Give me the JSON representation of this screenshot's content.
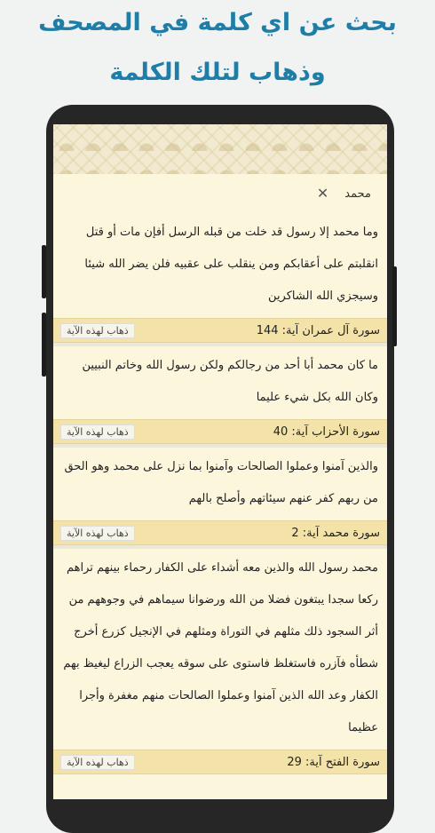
{
  "headline": {
    "line1": "بحث عن اي كلمة في المصحف",
    "line2": "وذهاب لتلك الكلمة"
  },
  "search": {
    "query": "محمد"
  },
  "results": [
    {
      "verse": "وما محمد إلا رسول قد خلت من قبله الرسل أفإن مات أو قتل انقلبتم على أعقابكم ومن ينقلب على عقبيه فلن يضر الله شيئا وسيجزي الله الشاكرين",
      "reference": "سورة آل عمران آية: 144",
      "go_label": "ذهاب لهذه الآية"
    },
    {
      "verse": "ما كان محمد أبا أحد من رجالكم ولكن رسول الله وخاتم النبيين وكان الله بكل شيء عليما",
      "reference": "سورة الأحزاب آية: 40",
      "go_label": "ذهاب لهذه الآية"
    },
    {
      "verse": "والذين آمنوا وعملوا الصالحات وآمنوا بما نزل على محمد وهو الحق من ربهم كفر عنهم سيئاتهم وأصلح بالهم",
      "reference": "سورة محمد آية: 2",
      "go_label": "ذهاب لهذه الآية"
    },
    {
      "verse": "محمد رسول الله والذين معه أشداء على الكفار رحماء بينهم تراهم ركعا سجدا يبتغون فضلا من الله ورضوانا سيماهم في وجوههم من أثر السجود ذلك مثلهم في التوراة ومثلهم في الإنجيل كزرع أخرج شطأه فآزره فاستغلظ فاستوى على سوقه يعجب الزراع ليغيظ بهم الكفار وعد الله الذين آمنوا وعملوا الصالحات منهم مغفرة وأجرا عظيما",
      "reference": "سورة الفتح آية: 29",
      "go_label": "ذهاب لهذه الآية"
    }
  ]
}
